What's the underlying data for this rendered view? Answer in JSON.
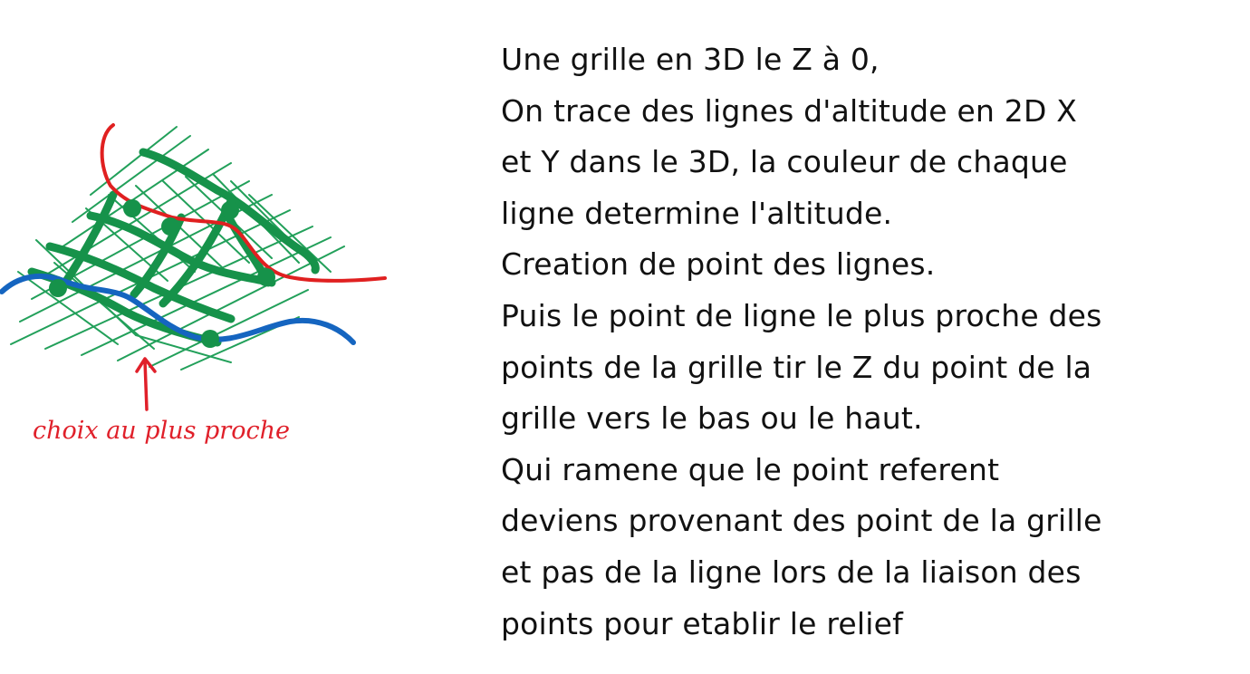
{
  "sketch": {
    "annotation": "choix au plus proche",
    "colors": {
      "grid": "#22a05a",
      "contour": "#16924a",
      "line_high": "#e02020",
      "line_low": "#1565c0",
      "annotation": "#e0202a"
    }
  },
  "notes": {
    "lines": [
      "Une grille en 3D le Z à 0,",
      "On trace des lignes d'altitude en 2D X",
      "et Y dans le 3D, la couleur de chaque",
      "ligne determine l'altitude.",
      "Creation de point des lignes.",
      "Puis le point de ligne le plus proche des",
      "points de la grille tir le Z du point de la",
      "grille vers le bas ou le haut.",
      "Qui ramene que le point referent",
      "deviens provenant des point de la grille",
      "et pas de la ligne lors de la liaison des",
      "points pour etablir le relief"
    ]
  }
}
